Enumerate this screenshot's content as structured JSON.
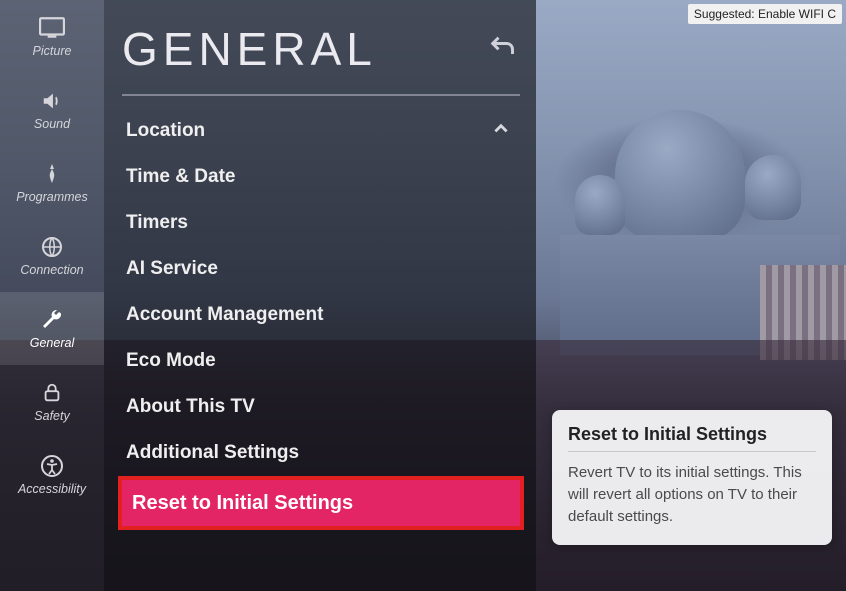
{
  "banner": {
    "text": "Suggested: Enable WIFI C"
  },
  "rail": {
    "items": [
      {
        "label": "Picture"
      },
      {
        "label": "Sound"
      },
      {
        "label": "Programmes"
      },
      {
        "label": "Connection"
      },
      {
        "label": "General"
      },
      {
        "label": "Safety"
      },
      {
        "label": "Accessibility"
      }
    ]
  },
  "panel": {
    "title": "GENERAL",
    "items": [
      {
        "label": "Location",
        "chevron": "up"
      },
      {
        "label": "Time & Date"
      },
      {
        "label": "Timers"
      },
      {
        "label": "AI Service"
      },
      {
        "label": "Account Management"
      },
      {
        "label": "Eco Mode"
      },
      {
        "label": "About This TV"
      },
      {
        "label": "Additional Settings"
      },
      {
        "label": "Reset to Initial Settings",
        "highlight": true
      }
    ]
  },
  "tooltip": {
    "title": "Reset to Initial Settings",
    "body": "Revert TV to its initial settings. This will revert all options on TV to their default settings."
  },
  "colors": {
    "highlight_bg": "#e32465",
    "highlight_border": "#e22020"
  }
}
